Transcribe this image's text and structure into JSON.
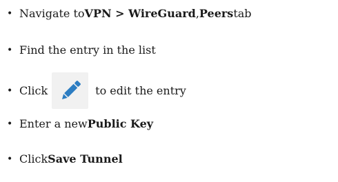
{
  "steps": [
    {
      "pre": "Navigate to ",
      "bold1": "VPN > WireGuard",
      "sep": ", ",
      "bold2": "Peers",
      "post": " tab"
    },
    {
      "text": "Find the entry in the list"
    },
    {
      "pre": "Click ",
      "icon": "pencil-edit-icon",
      "post": "to edit the entry"
    },
    {
      "pre": "Enter a new ",
      "bold": "Public Key"
    },
    {
      "pre": "Click ",
      "bold": "Save Tunnel"
    }
  ],
  "colors": {
    "icon_blue": "#2c7dc2",
    "icon_bg": "#f1f1f1"
  }
}
